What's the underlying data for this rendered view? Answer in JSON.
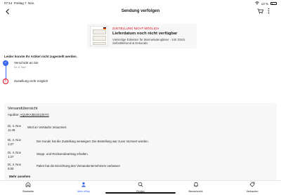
{
  "statusbar": {
    "time": "07:14",
    "date": "Freitag 7. Nov.",
    "battery": "13 %",
    "wifi_icon": "wifi-icon"
  },
  "nav": {
    "title": "Sendung verfolgen",
    "back_icon": "back-arrow-icon",
    "cart_icon": "cart-icon",
    "more_icon": "more-icon"
  },
  "item": {
    "status": "ZUSTELLUNG NICHT MÖGLICH",
    "headline": "Lieferdatum noch nicht verfügbar",
    "description": "Vielseitige Etiketten für Marmeladengläser - 240 Stück Selbstklebend & Dekorativ"
  },
  "notice": "Leider konnte Ihr Artikel nicht zugestellt werden.",
  "timeline": [
    {
      "label": "Verschickt an Sie",
      "date": "Di, 4. Nov",
      "state": "done"
    },
    {
      "label": "Zustellung nicht möglich",
      "state": "error"
    }
  ],
  "shipping": {
    "title": "Versandübersicht",
    "tracking_label": "Aquiline:",
    "tracking_number": "AQUIKA3B1SI125YG",
    "events": [
      {
        "date": "Di, 4. Nov",
        "time": "11:49",
        "message": "Wird an Verkäufer retourniert."
      },
      {
        "date": "Di, 4. Nov",
        "time": "1:27",
        "message": "Der Kunde hat die Zustellung verweigert: Die Bestellung war zuvor storniert worden."
      },
      {
        "date": "Di, 4. Nov",
        "time": "1:27",
        "message": "Stopp- und Rücksendeantrag erhalten."
      },
      {
        "date": "Di, 4. Nov",
        "time": "0:00",
        "message": "Paket hat die Einrichtung des Versandunternehmers verlassen"
      }
    ],
    "more_label": "Mehr ansehen"
  },
  "tabbar": [
    {
      "label": "Startseite",
      "icon": "home-icon",
      "active": false
    },
    {
      "label": "Mein eBay",
      "icon": "profile-icon",
      "active": true
    },
    {
      "label": "Finden",
      "icon": "search-icon",
      "active": false
    },
    {
      "label": "Benachricht.",
      "icon": "bell-icon",
      "active": false
    },
    {
      "label": "Verkaufen",
      "icon": "sell-icon",
      "active": false
    }
  ],
  "colors": {
    "accent": "#3665f3",
    "error": "#e0001a",
    "panel": "#f7f7f7"
  }
}
